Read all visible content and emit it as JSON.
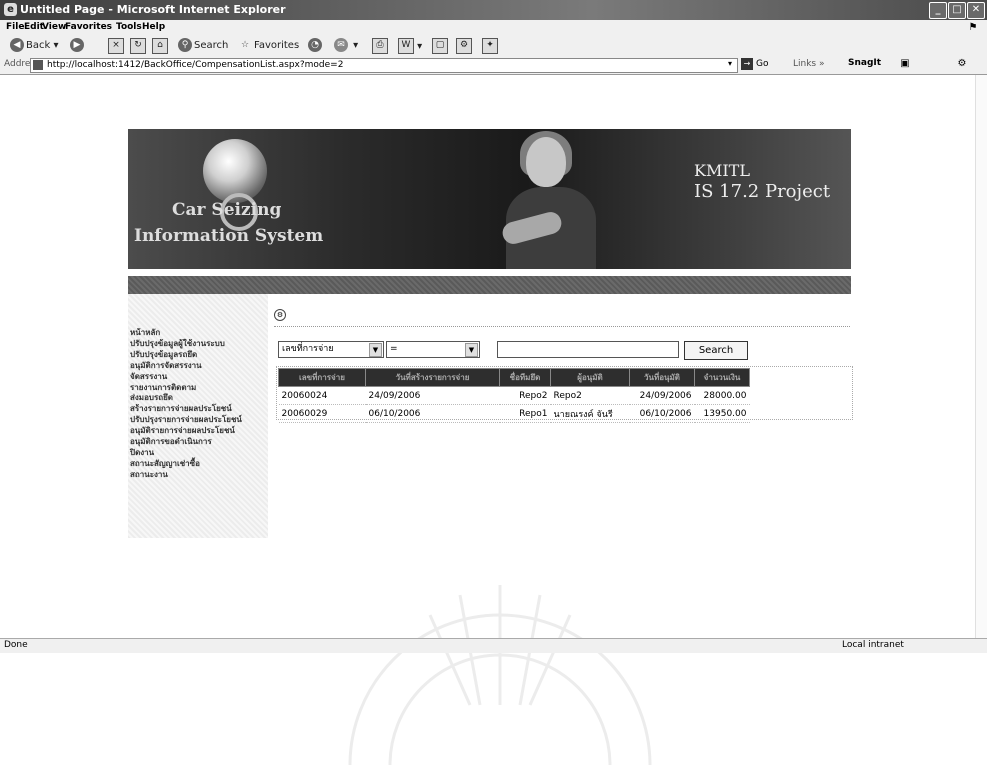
{
  "window": {
    "title": "Untitled Page - Microsoft Internet Explorer"
  },
  "menu": [
    "File",
    "Edit",
    "View",
    "Favorites",
    "Tools",
    "Help"
  ],
  "toolbar": {
    "back_label": "Back",
    "search_label": "Search",
    "favorites_label": "Favorites"
  },
  "address": {
    "label": "Address",
    "url": "http://localhost:1412/BackOffice/CompensationList.aspx?mode=2",
    "go_label": "Go",
    "links_label": "Links",
    "snagit_label": "SnagIt"
  },
  "banner": {
    "line1": "Car Seizing",
    "line2": "Information System",
    "right1": "KMITL",
    "right2": "IS 17.2 Project"
  },
  "sidebar": {
    "items": [
      "หน้าหลัก",
      "ปรับปรุงข้อมูลผู้ใช้งานระบบ",
      "ปรับปรุงข้อมูลรถยึด",
      "อนุมัติการจัดสรรงาน",
      "จัดสรรงาน",
      "รายงานการติดตาม",
      "ส่งมอบรถยึด",
      "สร้างรายการจ่ายผลประโยชน์",
      "ปรับปรุงรายการจ่ายผลประโยชน์",
      "อนุมัติรายการจ่ายผลประโยชน์",
      "อนุมัติการขอดำเนินการ",
      "ปิดงาน",
      "สถานะสัญญาเช่าซื้อ",
      "สถานะงาน"
    ]
  },
  "filter": {
    "field_value": "เลขที่การจ่าย",
    "operator_value": "=",
    "search_value": "",
    "search_button": "Search"
  },
  "grid": {
    "columns": [
      "เลขที่การจ่าย",
      "วันที่สร้างรายการจ่าย",
      "ชื่อทีมยึด",
      "ผู้อนุมัติ",
      "วันที่อนุมัติ",
      "จำนวนเงิน"
    ],
    "rows": [
      [
        "20060024",
        "24/09/2006",
        "Repo2",
        "Repo2",
        "24/09/2006",
        "28000.00"
      ],
      [
        "20060029",
        "06/10/2006",
        "Repo1",
        "นายณรงค์ จันรี",
        "06/10/2006",
        "13950.00"
      ]
    ]
  },
  "status": {
    "left": "Done",
    "right": "Local intranet"
  }
}
